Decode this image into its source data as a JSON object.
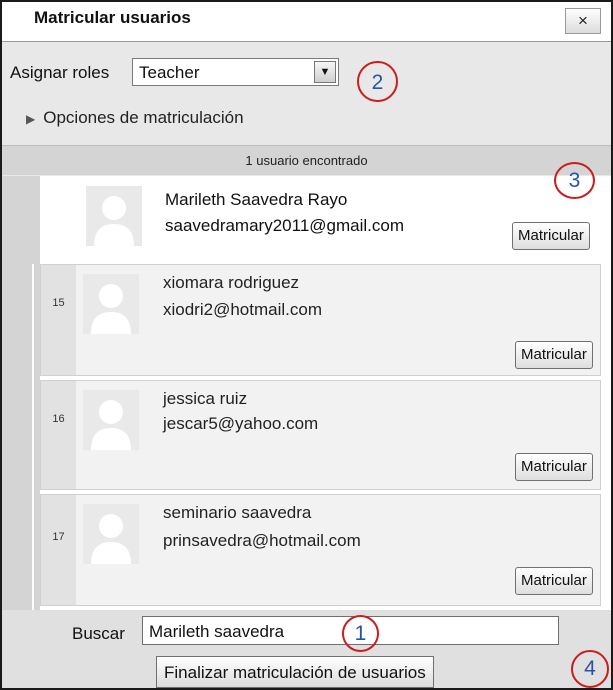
{
  "dialog": {
    "title": "Matricular usuarios",
    "close_label": "×"
  },
  "roles": {
    "label": "Asignar roles",
    "selected": "Teacher",
    "arrow": "▼"
  },
  "enrol_options": {
    "label": "Opciones de matriculación",
    "icon": "triangle-right-icon"
  },
  "results": {
    "found_text": "1 usuario encontrado",
    "found_user": {
      "name": "Marileth Saavedra Rayo",
      "email": "saavedramary2011@gmail.com",
      "button": "Matricular"
    },
    "candidates": [
      {
        "number": "15",
        "name": "xiomara rodriguez",
        "email": "xiodri2@hotmail.com",
        "button": "Matricular"
      },
      {
        "number": "16",
        "name": "jessica ruiz",
        "email": "jescar5@yahoo.com",
        "button": "Matricular"
      },
      {
        "number": "17",
        "name": "seminario saavedra",
        "email": "prinsavedra@hotmail.com",
        "button": "Matricular"
      }
    ]
  },
  "search": {
    "label": "Buscar",
    "value": "Marileth saavedra"
  },
  "finish_button": "Finalizar matriculación de usuarios",
  "markers": [
    "1",
    "2",
    "3",
    "4"
  ],
  "colors": {
    "marker_border": "#c81e1e",
    "marker_text": "#2853a4"
  }
}
